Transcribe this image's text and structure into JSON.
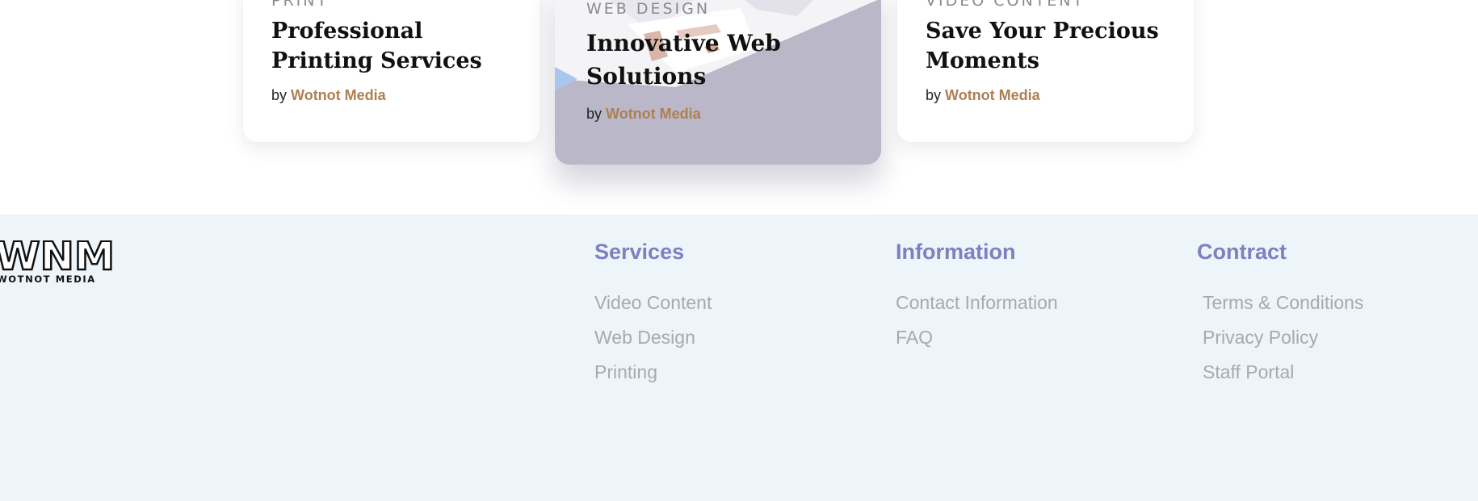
{
  "cards": [
    {
      "category": "PRINT",
      "title": "Professional Printing Services",
      "by": "by",
      "author": "Wotnot Media"
    },
    {
      "category": "WEB DESIGN",
      "title": "Innovative Web Solutions",
      "by": "by",
      "author": "Wotnot Media"
    },
    {
      "category": "VIDEO CONTENT",
      "title": "Save Your Precious Moments",
      "by": "by",
      "author": "Wotnot Media"
    }
  ],
  "footer": {
    "logo": {
      "mark": "WNM",
      "wordmark": "WOTNOT MEDIA"
    },
    "columns": [
      {
        "heading": "Services",
        "links": [
          "Video Content",
          "Web Design",
          "Printing"
        ]
      },
      {
        "heading": "Information",
        "links": [
          "Contact Information",
          "FAQ"
        ]
      },
      {
        "heading": "Contract",
        "links": [
          "Terms & Conditions",
          "Privacy Policy",
          "Staff Portal"
        ]
      }
    ]
  },
  "colors": {
    "author": "#ae7f51",
    "footer_heading": "#7e80bf",
    "footer_link": "#a9a9ae",
    "footer_bg": "#edf4fa",
    "highlight_card_bg": "#bab7c8"
  }
}
